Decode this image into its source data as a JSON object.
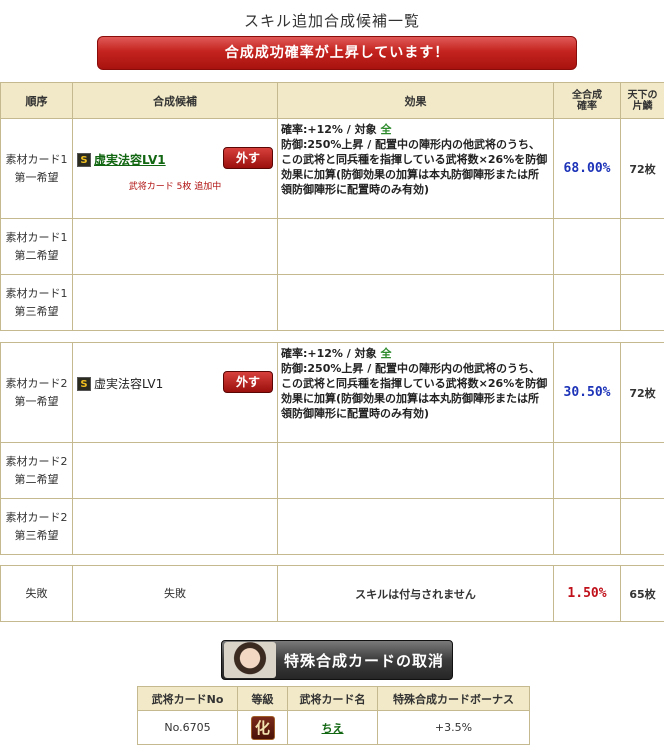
{
  "page_title": "スキル追加合成候補一覧",
  "banner": "合成成功確率が上昇しています！",
  "headers": {
    "order": "順序",
    "candidate": "合成候補",
    "effect": "効果",
    "total_rate_line1": "全合成",
    "total_rate_line2": "確率",
    "tenka_line1": "天下の",
    "tenka_line2": "片鱗"
  },
  "skill_effect": {
    "line1_prefix": "確率:+12% / 対象 ",
    "line1_target": "全",
    "body": "防御:250%上昇 / 配置中の陣形内の他武将のうち、この武将と同兵種を指揮している武将数×26%を防御効果に加算(防御効果の加算は本丸防御陣形または所領防御陣形に配置時のみ有効)"
  },
  "group1": {
    "rows": [
      {
        "order_line1": "素材カード1",
        "order_line2": "第一希望",
        "skill_icon": "S",
        "skill_name": "虚実法容LV1",
        "remove_label": "外す",
        "adding_note": "武将カード 5枚 追加中",
        "rate": "68.00%",
        "count": "72枚"
      },
      {
        "order_line1": "素材カード1",
        "order_line2": "第二希望"
      },
      {
        "order_line1": "素材カード1",
        "order_line2": "第三希望"
      }
    ]
  },
  "group2": {
    "rows": [
      {
        "order_line1": "素材カード2",
        "order_line2": "第一希望",
        "skill_icon": "S",
        "skill_name": "虚実法容LV1",
        "remove_label": "外す",
        "rate": "30.50%",
        "count": "72枚"
      },
      {
        "order_line1": "素材カード2",
        "order_line2": "第二希望"
      },
      {
        "order_line1": "素材カード2",
        "order_line2": "第三希望"
      }
    ]
  },
  "fail_row": {
    "order": "失敗",
    "candidate": "失敗",
    "effect": "スキルは付与されません",
    "rate": "1.50%",
    "count": "65枚"
  },
  "cancel_button": "特殊合成カードの取消",
  "bonus_table": {
    "headers": [
      "武将カードNo",
      "等級",
      "武将カード名",
      "特殊合成カードボーナス"
    ],
    "row": {
      "card_no": "No.6705",
      "rank": "化",
      "card_name": "ちえ",
      "bonus": "+3.5%"
    }
  },
  "colors": {
    "banner": "#c4231f",
    "rate_blue": "#1d33b8",
    "rate_red": "#c0101a",
    "header_bg": "#f1e9c7",
    "border": "#c5b98f"
  }
}
